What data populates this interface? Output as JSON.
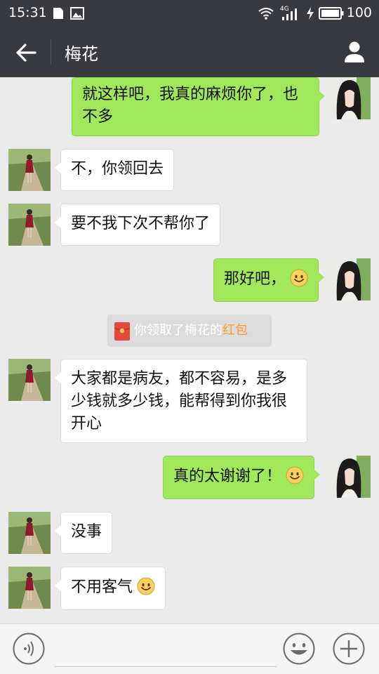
{
  "status_bar": {
    "time": "15:31",
    "network": "4G",
    "battery": "100"
  },
  "header": {
    "title": "梅花"
  },
  "messages": [
    {
      "text": "就这样吧，我真的麻烦你了，也不多"
    },
    {
      "text": "不，你领回去"
    },
    {
      "text": "要不我下次不帮你了"
    },
    {
      "text": "那好吧，"
    },
    {
      "text": "大家都是病友，都不容易，是多少钱就多少钱，能帮得到你我很开心"
    },
    {
      "text": "真的太谢谢了！"
    },
    {
      "text": "没事"
    },
    {
      "text": "不用客气"
    }
  ],
  "system_message": {
    "prefix": "你领取了梅花的",
    "link": "红包"
  },
  "input_bar": {
    "placeholder": ""
  },
  "colors": {
    "header_bg": "#393a3f",
    "outgoing_bubble": "#a0e75a",
    "incoming_bubble": "#ffffff",
    "red_packet_link": "#ff9a2e"
  }
}
